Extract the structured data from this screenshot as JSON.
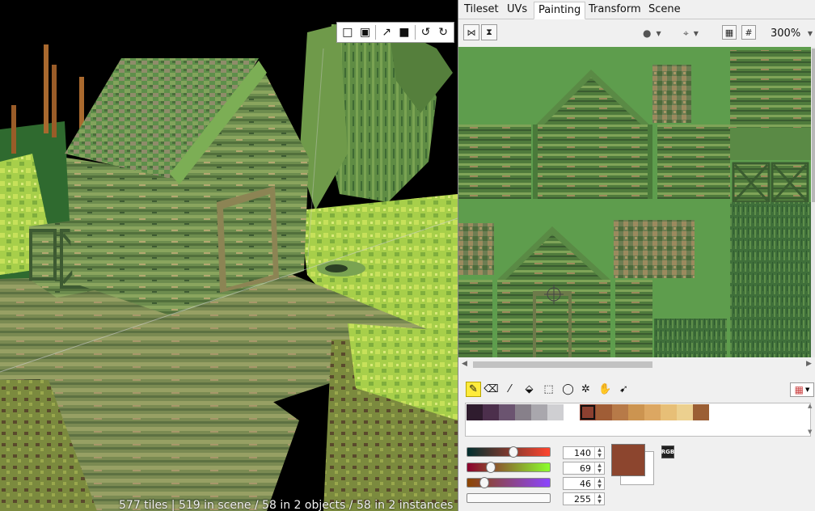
{
  "viewport": {
    "status": "577 tiles | 519 in scene / 58 in 2 objects / 58 in 2 instances",
    "toolbar": [
      {
        "name": "select-box-icon",
        "glyph": "□"
      },
      {
        "name": "select-cube-icon",
        "glyph": "▣"
      },
      {
        "name": "move-axes-icon",
        "glyph": "↗"
      },
      {
        "name": "solid-mode-icon",
        "glyph": "■"
      },
      {
        "name": "rotate-left-icon",
        "glyph": "↺"
      },
      {
        "name": "rotate-right-icon",
        "glyph": "↻"
      }
    ]
  },
  "tabs": [
    {
      "label": "Tileset",
      "active": false
    },
    {
      "label": "UVs",
      "active": false
    },
    {
      "label": "Painting",
      "active": true
    },
    {
      "label": "Transform",
      "active": false
    },
    {
      "label": "Scene",
      "active": false
    }
  ],
  "painting_toolbar": {
    "mirror_x_icon": "⋈",
    "mirror_y_icon": "⧗",
    "zoom": "300%"
  },
  "tools": [
    {
      "name": "pencil-tool-icon",
      "glyph": "✎",
      "active": true
    },
    {
      "name": "eraser-tool-icon",
      "glyph": "⌫",
      "active": false
    },
    {
      "name": "eyedropper-tool-icon",
      "glyph": "⁄",
      "active": false
    },
    {
      "name": "fill-tool-icon",
      "glyph": "⬙",
      "active": false
    },
    {
      "name": "rect-select-tool-icon",
      "glyph": "⬚",
      "active": false
    },
    {
      "name": "lasso-tool-icon",
      "glyph": "◯",
      "active": false
    },
    {
      "name": "magic-wand-tool-icon",
      "glyph": "✲",
      "active": false
    },
    {
      "name": "hand-tool-icon",
      "glyph": "✋",
      "active": false
    },
    {
      "name": "pointer-tool-icon",
      "glyph": "➹",
      "active": false
    }
  ],
  "palette": {
    "colors": [
      "#2f1c2e",
      "#4c2f4c",
      "#6b5470",
      "#87808a",
      "#a9a7ad",
      "#cfcfd2",
      "#ffffff",
      "#8c4030",
      "#a05d36",
      "#b77a48",
      "#cc9450",
      "#dca762",
      "#e7bf77",
      "#ecd08f",
      "#9b5f34"
    ],
    "selected_index": 7
  },
  "color": {
    "r": "140",
    "g": "69",
    "b": "46",
    "a": "255",
    "main": "#8c452e",
    "mode_label": "RGB"
  }
}
